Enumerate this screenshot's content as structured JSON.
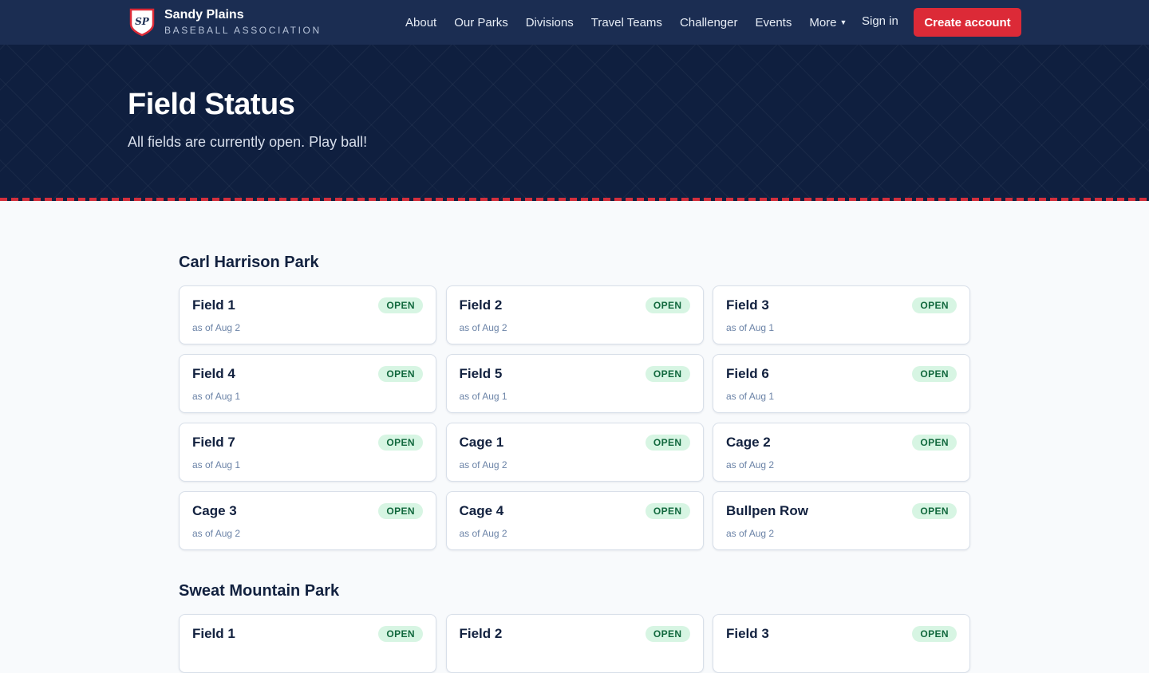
{
  "nav": {
    "brand_initials": "SP",
    "brand_name": "Sandy Plains",
    "brand_sub": "BASEBALL ASSOCIATION",
    "items": [
      "About",
      "Our Parks",
      "Divisions",
      "Travel Teams",
      "Challenger",
      "Events",
      "More"
    ],
    "signin": "Sign in",
    "create": "Create account",
    "colors": {
      "nav_bg": "#1b2d52",
      "accent": "#dc2a37"
    }
  },
  "hero": {
    "title": "Field Status",
    "subtitle": "All fields are currently open. Play ball!"
  },
  "parks": [
    {
      "name": "Carl Harrison Park",
      "fields": [
        {
          "name": "Field 1",
          "status": "OPEN",
          "asof": "as of Aug 2"
        },
        {
          "name": "Field 2",
          "status": "OPEN",
          "asof": "as of Aug 2"
        },
        {
          "name": "Field 3",
          "status": "OPEN",
          "asof": "as of Aug 1"
        },
        {
          "name": "Field 4",
          "status": "OPEN",
          "asof": "as of Aug 1"
        },
        {
          "name": "Field 5",
          "status": "OPEN",
          "asof": "as of Aug 1"
        },
        {
          "name": "Field 6",
          "status": "OPEN",
          "asof": "as of Aug 1"
        },
        {
          "name": "Field 7",
          "status": "OPEN",
          "asof": "as of Aug 1"
        },
        {
          "name": "Cage 1",
          "status": "OPEN",
          "asof": "as of Aug 2"
        },
        {
          "name": "Cage 2",
          "status": "OPEN",
          "asof": "as of Aug 2"
        },
        {
          "name": "Cage 3",
          "status": "OPEN",
          "asof": "as of Aug 2"
        },
        {
          "name": "Cage 4",
          "status": "OPEN",
          "asof": "as of Aug 2"
        },
        {
          "name": "Bullpen Row",
          "status": "OPEN",
          "asof": "as of Aug 2"
        }
      ]
    },
    {
      "name": "Sweat Mountain Park",
      "fields": [
        {
          "name": "Field 1",
          "status": "OPEN",
          "asof": ""
        },
        {
          "name": "Field 2",
          "status": "OPEN",
          "asof": ""
        },
        {
          "name": "Field 3",
          "status": "OPEN",
          "asof": ""
        }
      ]
    }
  ]
}
